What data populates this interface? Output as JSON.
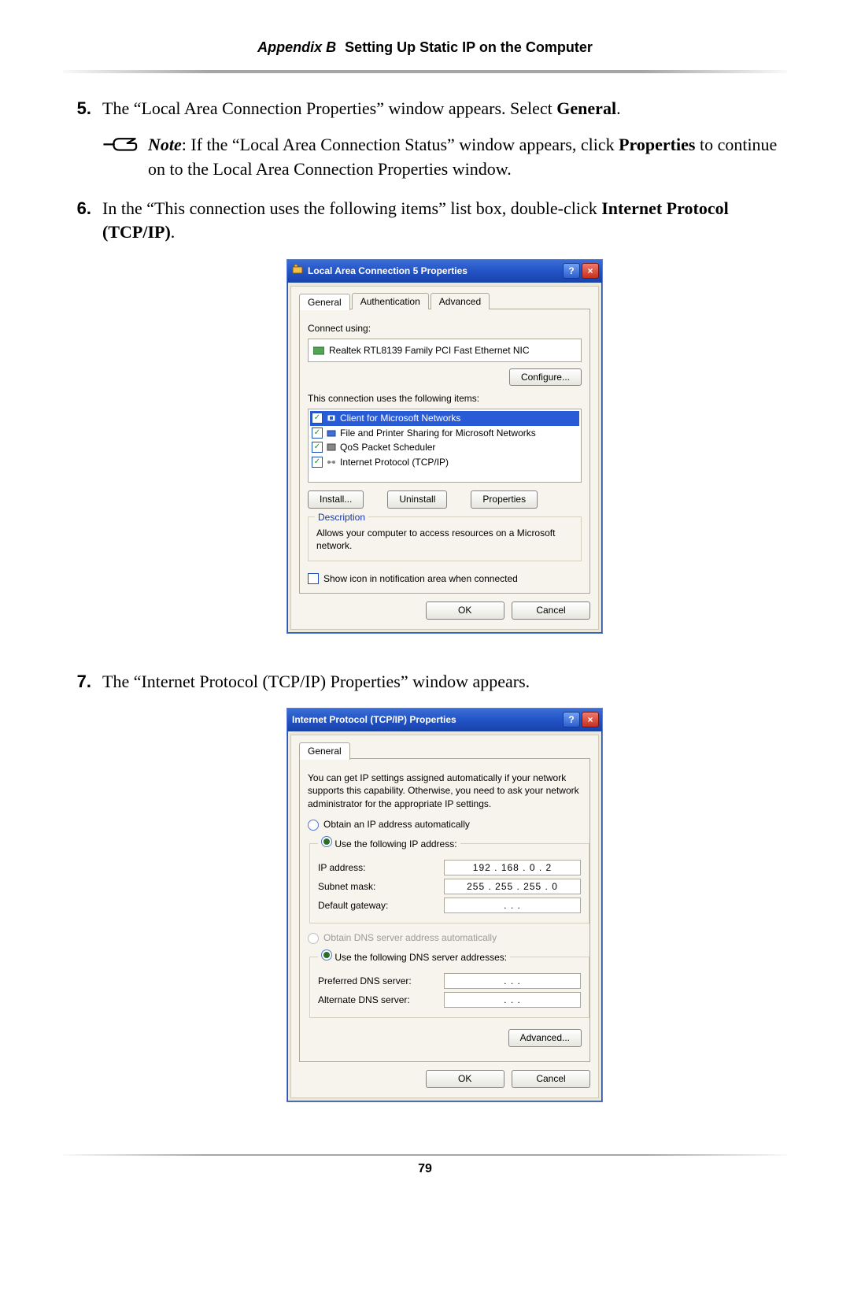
{
  "header": {
    "appendix": "Appendix B",
    "title": "Setting Up Static IP on the Computer"
  },
  "footer": {
    "page_number": "79"
  },
  "step5": {
    "num": "5.",
    "pre": "The “Local Area Connection Properties” window appears. Select ",
    "bold": "General",
    "post": ".",
    "note": {
      "label": "Note",
      "sep": ": ",
      "part1": "If the “Local Area Connection Status” window appears, click ",
      "bold": "Properties",
      "part2": " to continue on to the Local Area Connection Properties window."
    }
  },
  "step6": {
    "num": "6.",
    "pre": "In the “This connection uses the following items” list box, double-click ",
    "bold": "Internet Protocol",
    "sc": " (TCP/IP)",
    "post": "."
  },
  "step7": {
    "num": "7.",
    "pre": "The “Internet Protocol ",
    "sc": "(TCP/IP)",
    "post": " Properties” window appears."
  },
  "win1": {
    "title": "Local Area Connection 5 Properties",
    "tabs": {
      "general": "General",
      "auth": "Authentication",
      "adv": "Advanced"
    },
    "connect_using_label": "Connect using:",
    "nic": "Realtek RTL8139 Family PCI Fast Ethernet NIC",
    "configure": "Configure...",
    "items_label": "This connection uses the following items:",
    "items": [
      "Client for Microsoft Networks",
      "File and Printer Sharing for Microsoft Networks",
      "QoS Packet Scheduler",
      "Internet Protocol (TCP/IP)"
    ],
    "install": "Install...",
    "uninstall": "Uninstall",
    "properties": "Properties",
    "description_label": "Description",
    "description_text": "Allows your computer to access resources on a Microsoft network.",
    "show_icon": "Show icon in notification area when connected",
    "ok": "OK",
    "cancel": "Cancel"
  },
  "win2": {
    "title": "Internet Protocol (TCP/IP) Properties",
    "tab_general": "General",
    "intro": "You can get IP settings assigned automatically if your network supports this capability. Otherwise, you need to ask your network administrator for the appropriate IP settings.",
    "obtain_ip": "Obtain an IP address automatically",
    "use_ip": "Use the following IP address:",
    "ip_label": "IP address:",
    "ip_value": "192 . 168 .  0  .  2",
    "mask_label": "Subnet mask:",
    "mask_value": "255 . 255 . 255 .  0",
    "gw_label": "Default gateway:",
    "gw_value": ".          .          .",
    "obtain_dns": "Obtain DNS server address automatically",
    "use_dns": "Use the following DNS server addresses:",
    "pref_dns_label": "Preferred DNS server:",
    "pref_dns_value": ".          .          .",
    "alt_dns_label": "Alternate DNS server:",
    "alt_dns_value": ".          .          .",
    "advanced": "Advanced...",
    "ok": "OK",
    "cancel": "Cancel"
  }
}
